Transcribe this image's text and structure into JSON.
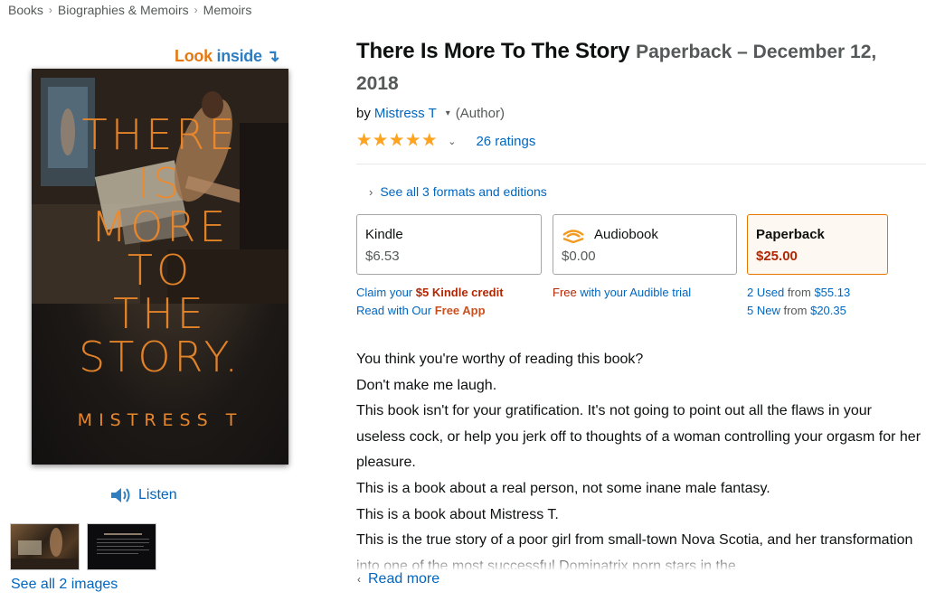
{
  "breadcrumb": [
    "Books",
    "Biographies & Memoirs",
    "Memoirs"
  ],
  "breadcrumb_sep": "›",
  "look_inside": {
    "part1": "Look",
    "part2": "inside",
    "arrow": "↴"
  },
  "cover": {
    "title_lines": [
      "THERE",
      "IS",
      "MORE",
      "TO",
      "THE",
      "STORY."
    ],
    "author": "MISTRESS T"
  },
  "listen_label": "Listen",
  "see_all_images": "See all 2 images",
  "product": {
    "title": "There Is More To The Story",
    "format_date": "Paperback – December 12, 2018",
    "by": "by",
    "author": "Mistress T",
    "author_role": "(Author)",
    "rating": 4.5,
    "ratings_count": "26 ratings"
  },
  "formats_link": "See all 3 formats and editions",
  "formats": [
    {
      "name": "Kindle",
      "price": "$6.53"
    },
    {
      "name": "Audiobook",
      "price": "$0.00"
    },
    {
      "name": "Paperback",
      "price": "$25.00"
    }
  ],
  "kindle_links": {
    "claim_prefix": "Claim your ",
    "claim_highlight": "$5 Kindle credit",
    "read_prefix": "Read with Our ",
    "read_highlight": "Free App"
  },
  "audible_link": {
    "prefix": "Free",
    "suffix": " with your Audible trial"
  },
  "paperback_links": {
    "used_count": "2 Used",
    "used_from": " from ",
    "used_price": "$55.13",
    "new_count": "5 New",
    "new_from": " from ",
    "new_price": "$20.35"
  },
  "description": [
    "You think you're worthy of reading this book?",
    "Don't make me laugh.",
    "This book isn't for your gratification. It's not going to point out all the flaws in your useless cock, or help you jerk off to thoughts of a woman controlling your orgasm for her pleasure.",
    "This is a book about a real person, not some inane male fantasy.",
    "This is a book about Mistress T.",
    "This is the true story of a poor girl from small-town Nova Scotia, and her transformation into one of the most successful Dominatrix porn stars in the"
  ],
  "read_more": "Read more",
  "colors": {
    "link": "#0066c0",
    "star": "#ffa41c",
    "price_red": "#b12704",
    "look_orange": "#e47911",
    "selected_border": "#e77600"
  }
}
